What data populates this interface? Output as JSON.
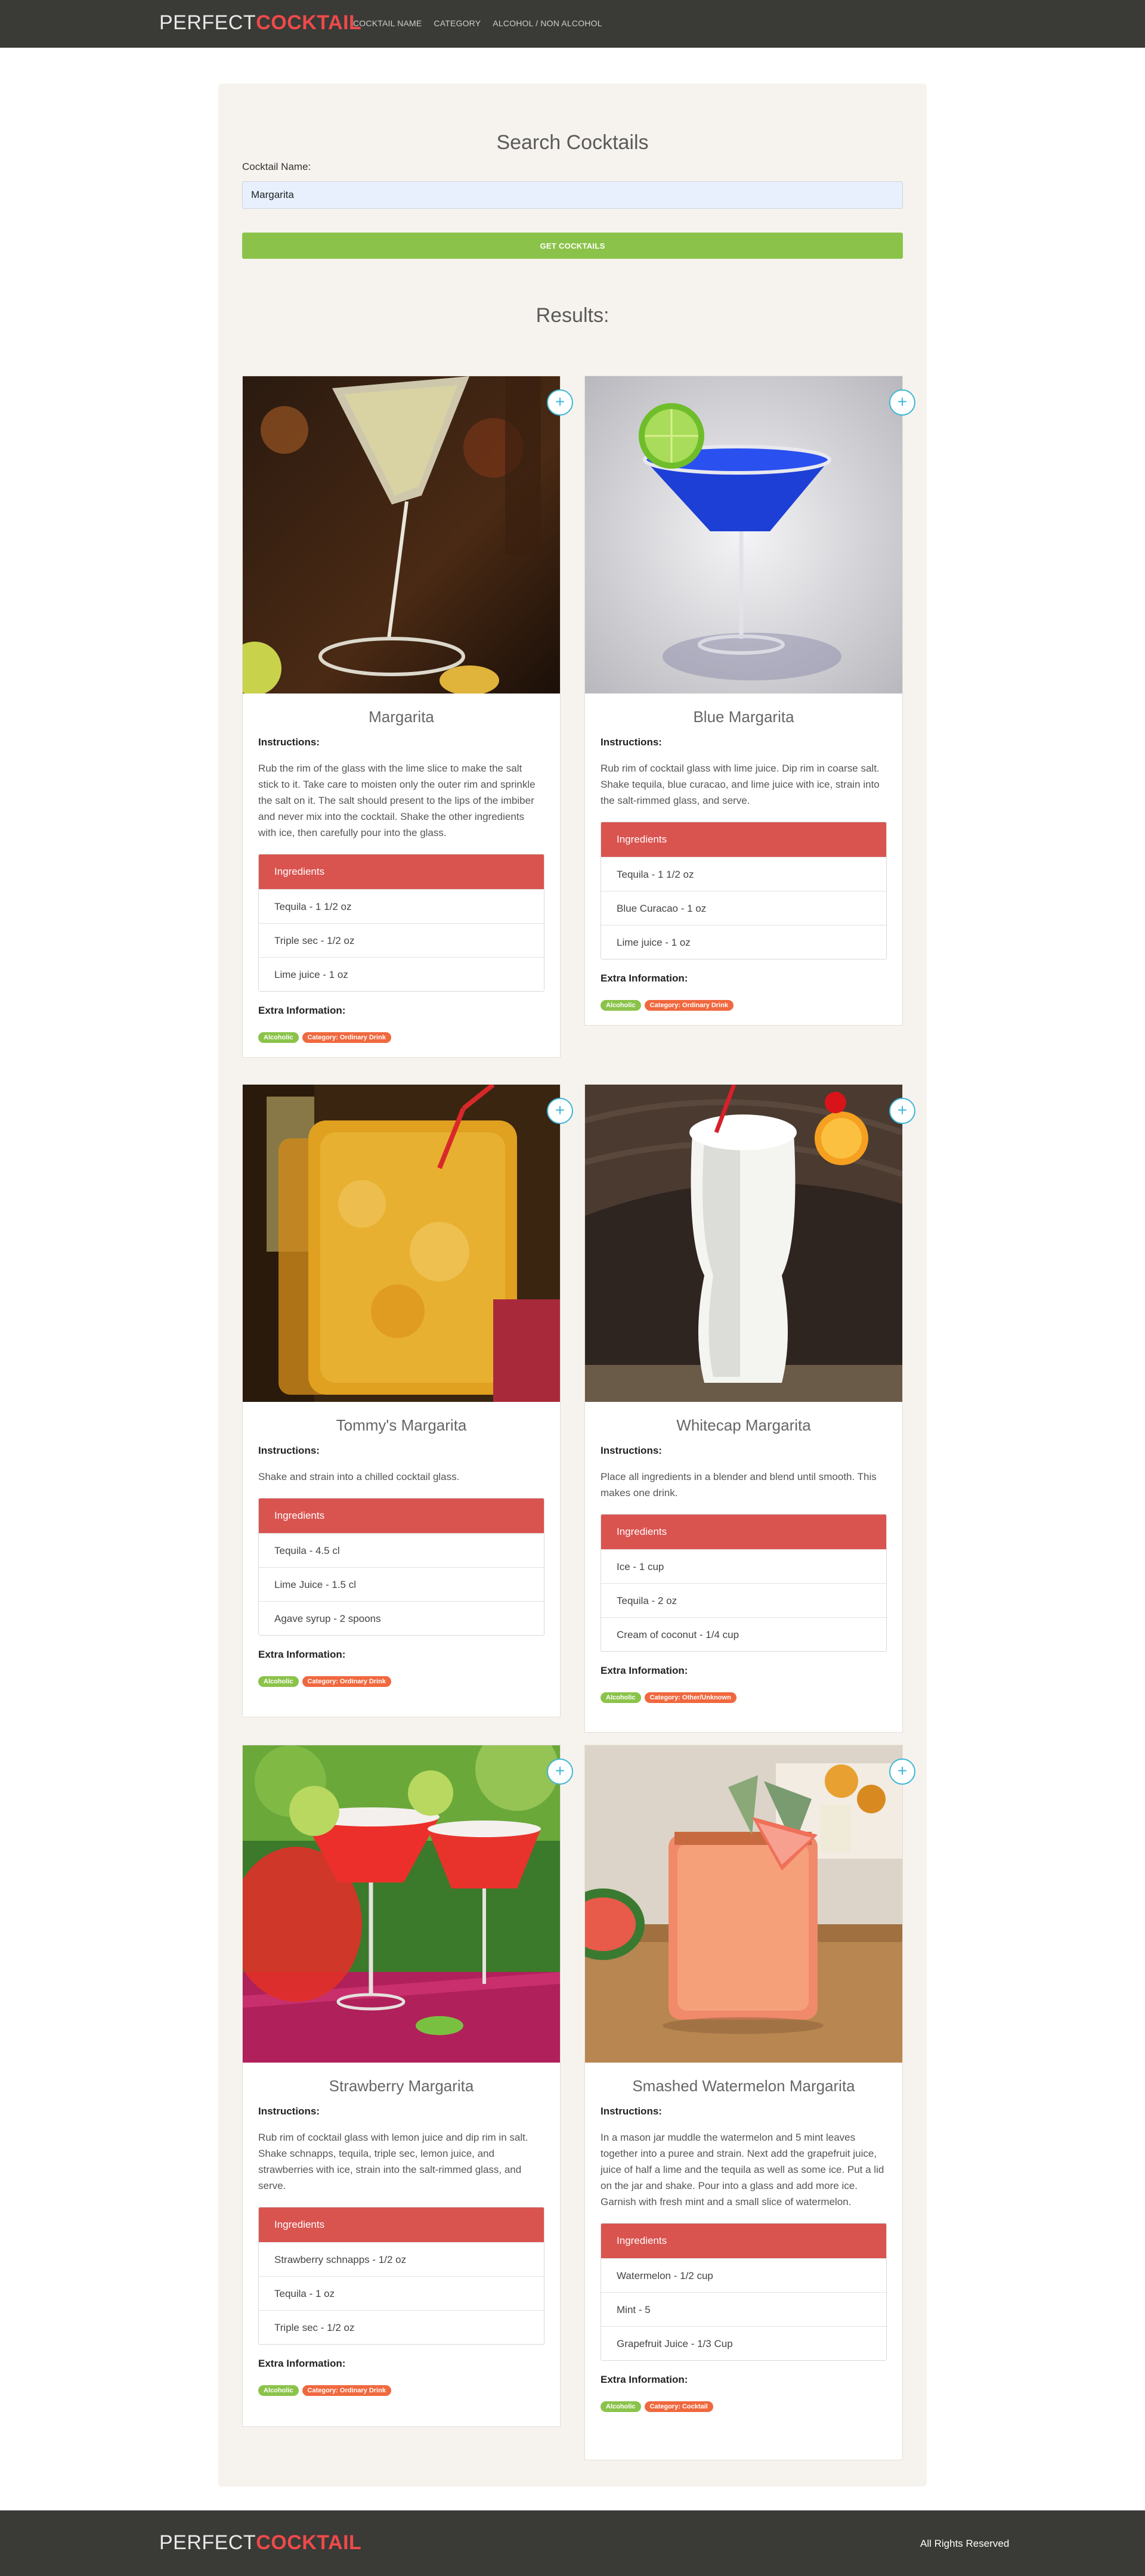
{
  "nav": {
    "brand_part1": "PERFECT",
    "brand_part2": "COCKTAIL",
    "links": [
      "COCKTAIL NAME",
      "CATEGORY",
      "ALCOHOL / NON ALCOHOL"
    ]
  },
  "search": {
    "title": "Search Cocktails",
    "label": "Cocktail Name:",
    "value": "Margarita",
    "button": "GET COCKTAILS"
  },
  "results_title": "Results:",
  "labels": {
    "instructions": "Instructions:",
    "ingredients": "Ingredients",
    "extra": "Extra Information:",
    "add": "+"
  },
  "cocktails": [
    {
      "name": "Margarita",
      "instructions": "Rub the rim of the glass with the lime slice to make the salt stick to it. Take care to moisten only the outer rim and sprinkle the salt on it. The salt should present to the lips of the imbiber and never mix into the cocktail. Shake the other ingredients with ice, then carefully pour into the glass.",
      "ingredients": [
        "Tequila - 1 1/2 oz",
        "Triple sec - 1/2 oz",
        "Lime juice - 1 oz"
      ],
      "alcoholic": "Alcoholic",
      "category": "Category: Ordinary Drink"
    },
    {
      "name": "Blue Margarita",
      "instructions": "Rub rim of cocktail glass with lime juice. Dip rim in coarse salt. Shake tequila, blue curacao, and lime juice with ice, strain into the salt-rimmed glass, and serve.",
      "ingredients": [
        "Tequila - 1 1/2 oz",
        "Blue Curacao - 1 oz",
        "Lime juice - 1 oz"
      ],
      "alcoholic": "Alcoholic",
      "category": "Category: Ordinary Drink"
    },
    {
      "name": "Tommy's Margarita",
      "instructions": "Shake and strain into a chilled cocktail glass.",
      "ingredients": [
        "Tequila - 4.5 cl",
        "Lime Juice - 1.5 cl",
        "Agave syrup - 2 spoons"
      ],
      "alcoholic": "Alcoholic",
      "category": "Category: Ordinary Drink"
    },
    {
      "name": "Whitecap Margarita",
      "instructions": "Place all ingredients in a blender and blend until smooth. This makes one drink.",
      "ingredients": [
        "Ice - 1 cup",
        "Tequila - 2 oz",
        "Cream of coconut - 1/4 cup"
      ],
      "alcoholic": "Alcoholic",
      "category": "Category: Other/Unknown"
    },
    {
      "name": "Strawberry Margarita",
      "instructions": "Rub rim of cocktail glass with lemon juice and dip rim in salt. Shake schnapps, tequila, triple sec, lemon juice, and strawberries with ice, strain into the salt-rimmed glass, and serve.",
      "ingredients": [
        "Strawberry schnapps - 1/2 oz",
        "Tequila - 1 oz",
        "Triple sec - 1/2 oz"
      ],
      "alcoholic": "Alcoholic",
      "category": "Category: Ordinary Drink"
    },
    {
      "name": "Smashed Watermelon Margarita",
      "instructions": "In a mason jar muddle the watermelon and 5 mint leaves together into a puree and strain. Next add the grapefruit juice, juice of half a lime and the tequila as well as some ice. Put a lid on the jar and shake. Pour into a glass and add more ice. Garnish with fresh mint and a small slice of watermelon.",
      "ingredients": [
        "Watermelon - 1/2 cup",
        "Mint - 5",
        "Grapefruit Juice - 1/3 Cup"
      ],
      "alcoholic": "Alcoholic",
      "category": "Category: Cocktail"
    }
  ],
  "footer": {
    "brand_part1": "PERFECT",
    "brand_part2": "COCKTAIL",
    "rights": "All Rights Reserved"
  },
  "colors": {
    "nav_bg": "#3a3a37",
    "brand_accent": "#ee4a4a",
    "button_green": "#8bc34a",
    "ingredients_red": "#d9534f",
    "plus_blue": "#3db6d6",
    "category_orange": "#f0683e"
  }
}
